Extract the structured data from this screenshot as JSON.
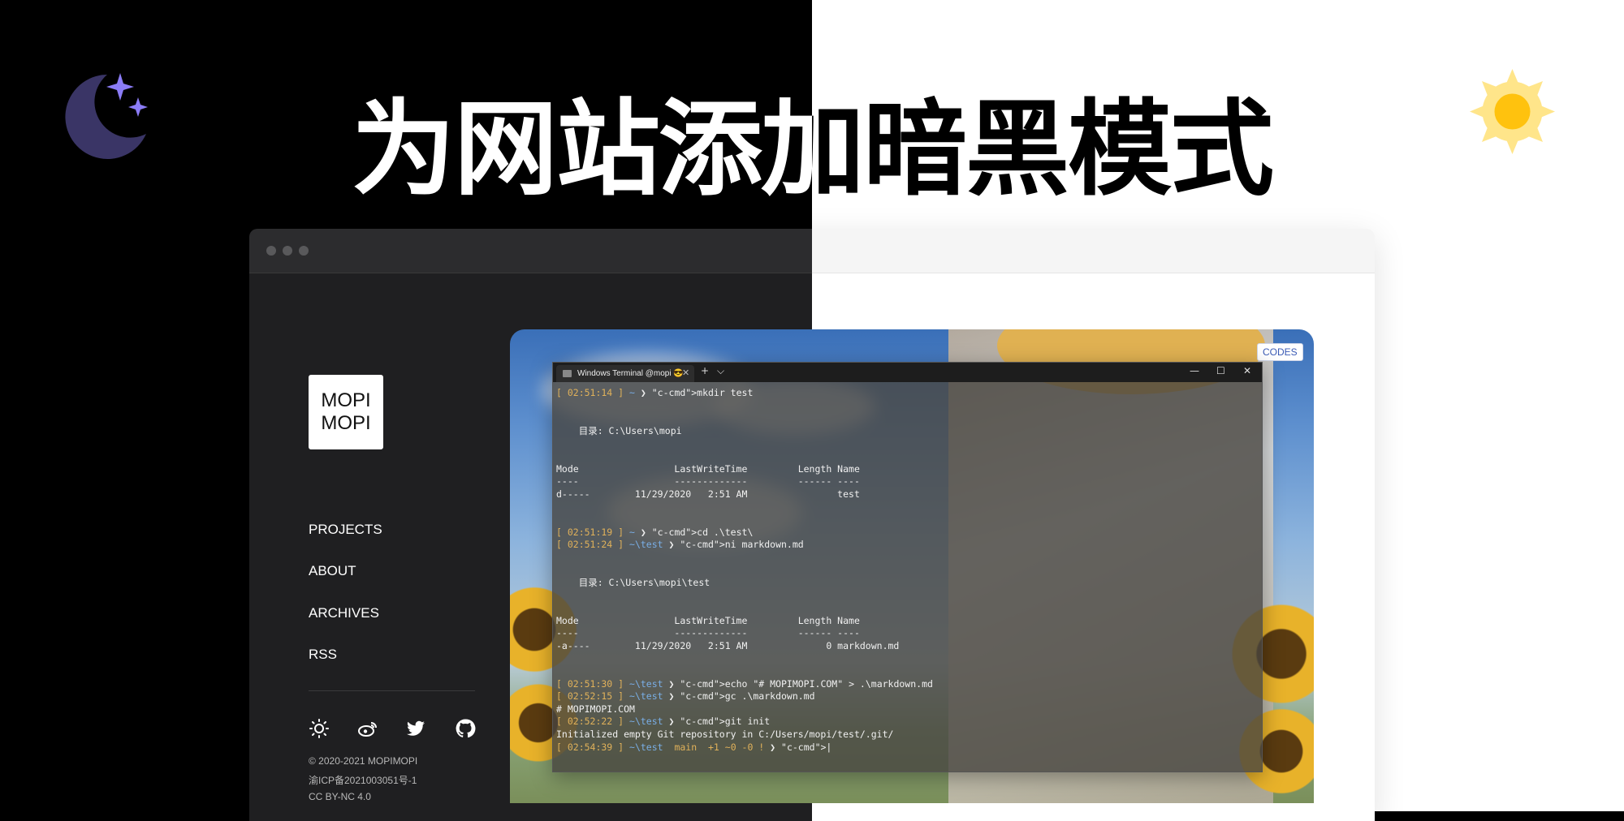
{
  "title": "为网站添加暗黑模式",
  "icons": {
    "moon": "moon-sparkles-icon",
    "sun": "sun-icon"
  },
  "colors": {
    "moon": "#3a3566",
    "sparkle": "#8b7cf6",
    "sun_core": "#ffc20e",
    "sun_glow": "#ffe58a",
    "dark_bg": "#1f1f21",
    "light_bg": "#ffffff"
  },
  "site": {
    "logo_line1": "MOPI",
    "logo_line2": "MOPI",
    "nav": [
      "PROJECTS",
      "ABOUT",
      "ARCHIVES",
      "RSS"
    ],
    "social_icons": [
      "theme-toggle-icon",
      "weibo-icon",
      "twitter-icon",
      "github-icon"
    ],
    "footer": [
      "© 2020-2021 MOPIMOPI",
      "渝ICP备2021003051号-1",
      "CC BY-NC 4.0"
    ]
  },
  "card": {
    "badge": "CODES"
  },
  "terminal": {
    "tab_title": "Windows Terminal @mopi 😎",
    "tab_close": "✕",
    "new_tab": "+",
    "dropdown": "⌵",
    "minimize": "—",
    "maximize": "☐",
    "close": "✕",
    "lines": [
      "[ 02:51:14 ] ~ ❯ mkdir test",
      "",
      "",
      "    目录: C:\\Users\\mopi",
      "",
      "",
      "Mode                 LastWriteTime         Length Name",
      "----                 -------------         ------ ----",
      "d-----        11/29/2020   2:51 AM                test",
      "",
      "",
      "[ 02:51:19 ] ~ ❯ cd .\\test\\",
      "[ 02:51:24 ] ~\\test ❯ ni markdown.md",
      "",
      "",
      "    目录: C:\\Users\\mopi\\test",
      "",
      "",
      "Mode                 LastWriteTime         Length Name",
      "----                 -------------         ------ ----",
      "-a----        11/29/2020   2:51 AM              0 markdown.md",
      "",
      "",
      "[ 02:51:30 ] ~\\test ❯ echo \"# MOPIMOPI.COM\" > .\\markdown.md",
      "[ 02:52:15 ] ~\\test ❯ gc .\\markdown.md",
      "# MOPIMOPI.COM",
      "[ 02:52:22 ] ~\\test ❯ git init",
      "Initialized empty Git repository in C:/Users/mopi/test/.git/",
      "[ 02:54:39 ] ~\\test  main  +1 ~0 -0 ! ❯ |"
    ]
  }
}
